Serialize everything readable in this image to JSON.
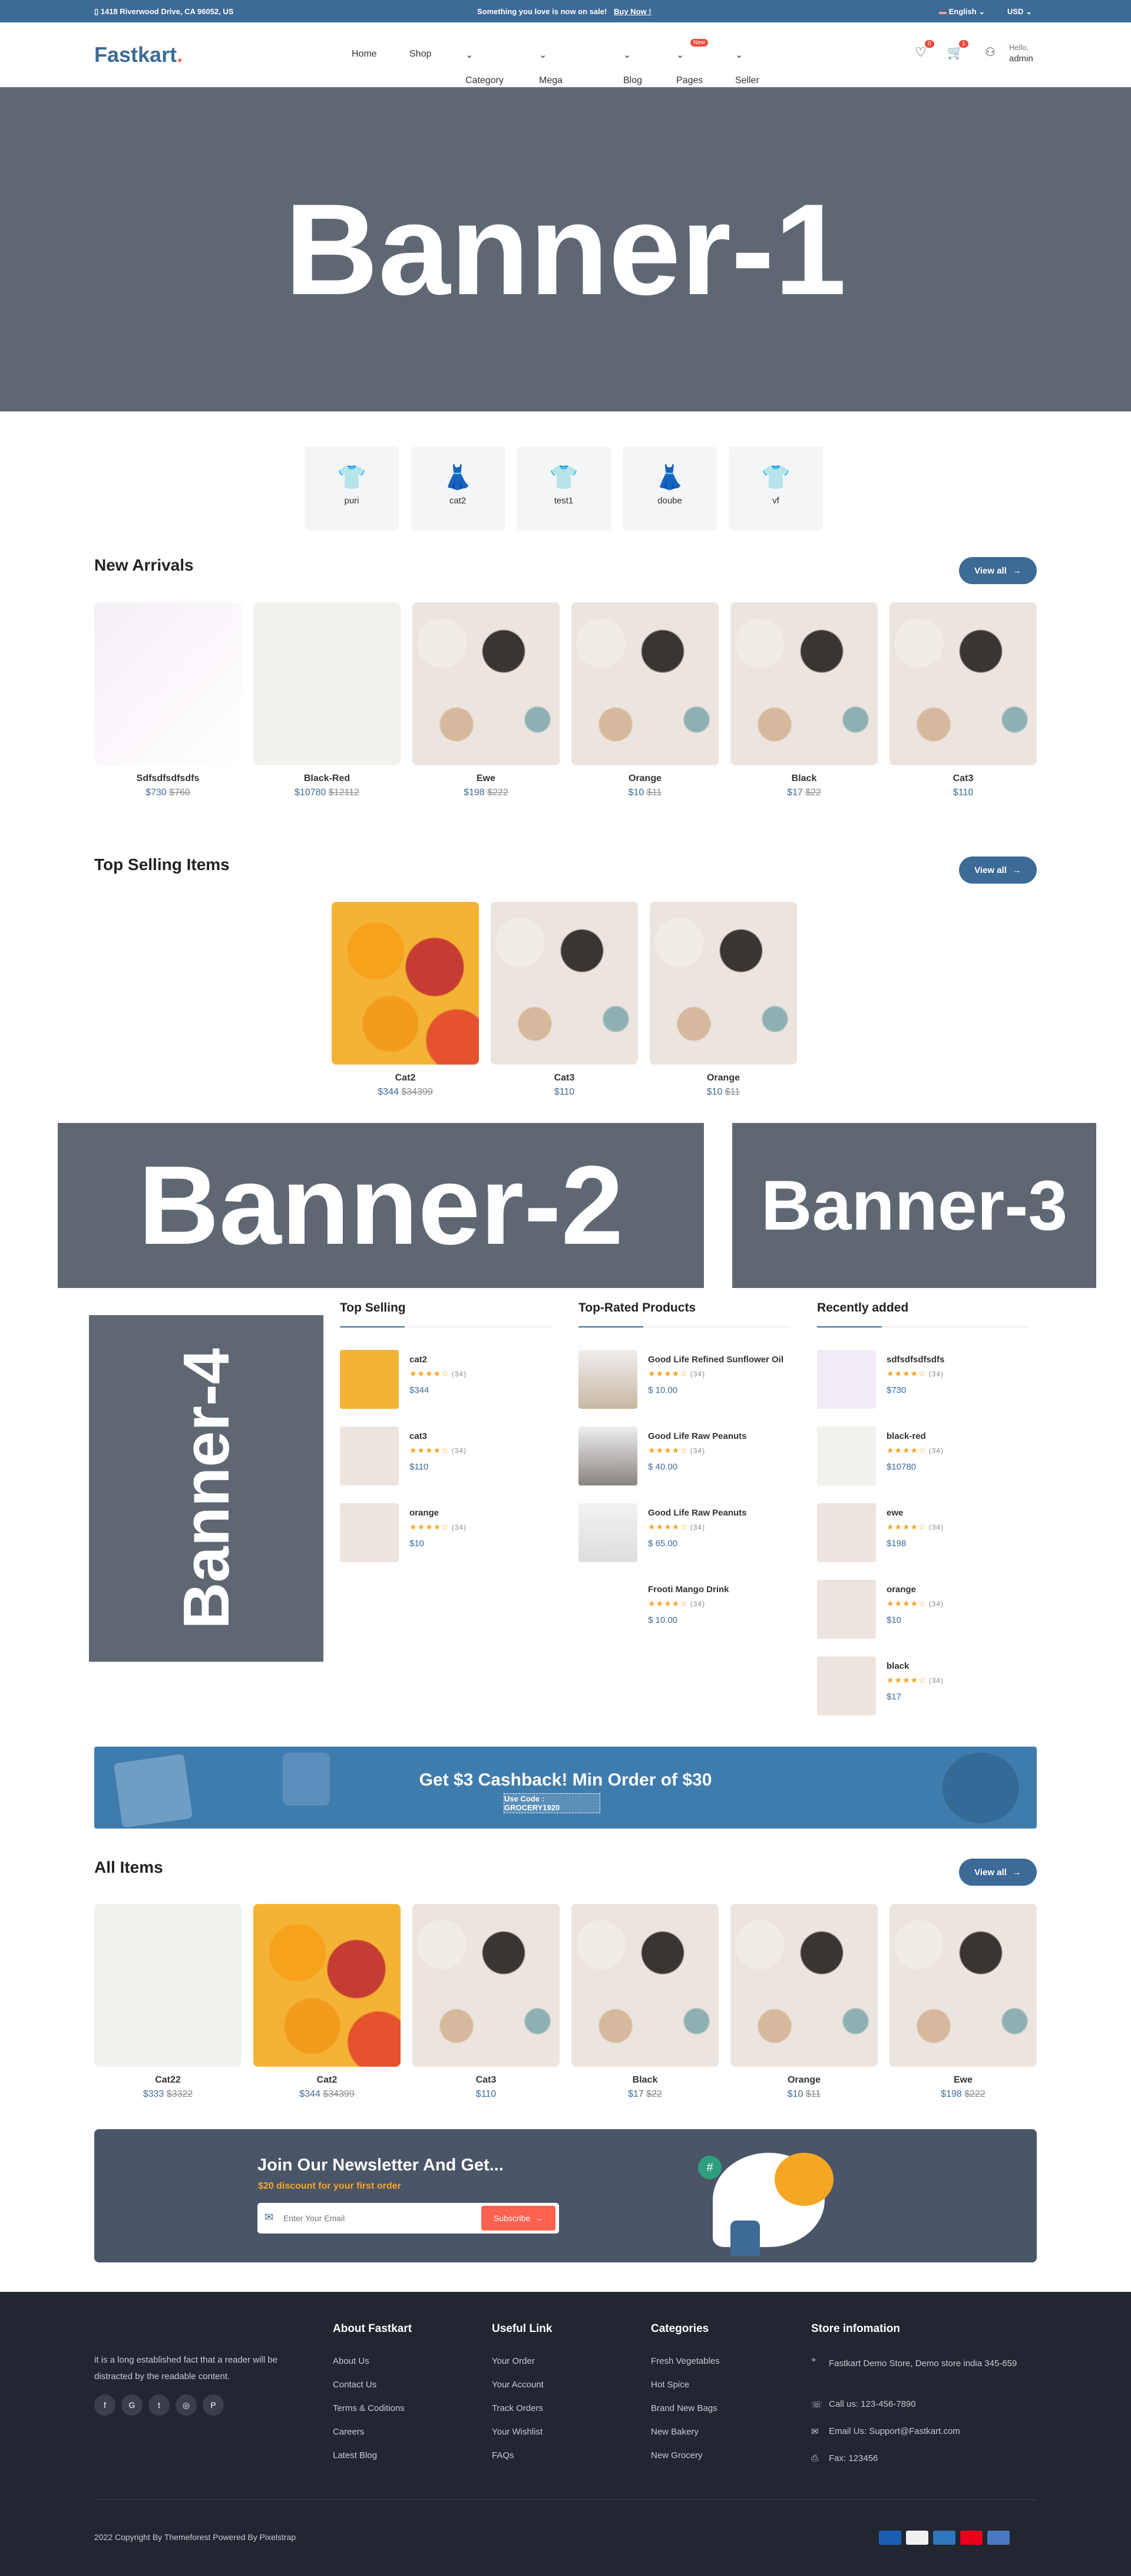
{
  "topbar": {
    "address": "1418 Riverwood Drive, CA 96052, US",
    "promo": "Something you love is now on sale!",
    "promo_link": "Buy Now !",
    "language": "English",
    "currency": "USD"
  },
  "header": {
    "logo": "Fastkart",
    "nav": [
      "Home",
      "Shop",
      "Category",
      "Mega Menu",
      "Blog",
      "Pages",
      "Seller"
    ],
    "new_badge": "New",
    "wishlist_count": "0",
    "cart_count": "1",
    "greeting": "Hello,",
    "user": "admin"
  },
  "banners": {
    "b1": "Banner-1",
    "b2": "Banner-2",
    "b3": "Banner-3",
    "b4": "Banner-4"
  },
  "categories": [
    "puri",
    "cat2",
    "test1",
    "doube",
    "vf"
  ],
  "new_arrivals": {
    "title": "New Arrivals",
    "view_all": "View all",
    "items": [
      {
        "name": "Sdfsdfsdfsdfs",
        "price": "$730",
        "old": "$760",
        "img": "grad"
      },
      {
        "name": "Black-Red",
        "price": "$10780",
        "old": "$12112",
        "img": "leather"
      },
      {
        "name": "Ewe",
        "price": "$198",
        "old": "$222",
        "img": "tea"
      },
      {
        "name": "Orange",
        "price": "$10",
        "old": "$11",
        "img": "tea"
      },
      {
        "name": "Black",
        "price": "$17",
        "old": "$22",
        "img": "tea"
      },
      {
        "name": "Cat3",
        "price": "$110",
        "old": "",
        "img": "tea"
      }
    ]
  },
  "top_selling": {
    "title": "Top Selling Items",
    "view_all": "View all",
    "items": [
      {
        "name": "Cat2",
        "price": "$344",
        "old": "$34399",
        "img": "fruit"
      },
      {
        "name": "Cat3",
        "price": "$110",
        "old": "",
        "img": "tea"
      },
      {
        "name": "Orange",
        "price": "$10",
        "old": "$11",
        "img": "tea"
      }
    ]
  },
  "columns": [
    {
      "title": "Top Selling",
      "items": [
        {
          "name": "cat2",
          "price": "$344",
          "reviews": "(34)",
          "img": "fruit"
        },
        {
          "name": "cat3",
          "price": "$110",
          "reviews": "(34)",
          "img": "tea"
        },
        {
          "name": "orange",
          "price": "$10",
          "reviews": "(34)",
          "img": "tea"
        }
      ]
    },
    {
      "title": "Top-Rated Products",
      "items": [
        {
          "name": "Good Life Refined Sunflower Oil",
          "price": "$ 10.00",
          "reviews": "(34)",
          "img": "person1"
        },
        {
          "name": "Good Life Raw Peanuts",
          "price": "$ 40.00",
          "reviews": "(34)",
          "img": "person2"
        },
        {
          "name": "Good Life Raw Peanuts",
          "price": "$ 65.00",
          "reviews": "(34)",
          "img": "person3"
        },
        {
          "name": "Frooti Mango Drink",
          "price": "$ 10.00",
          "reviews": "(34)",
          "img": "none"
        }
      ]
    },
    {
      "title": "Recently added",
      "items": [
        {
          "name": "sdfsdfsdfsdfs",
          "price": "$730",
          "reviews": "(34)",
          "img": "grad"
        },
        {
          "name": "black-red",
          "price": "$10780",
          "reviews": "(34)",
          "img": "leather"
        },
        {
          "name": "ewe",
          "price": "$198",
          "reviews": "(34)",
          "img": "tea"
        },
        {
          "name": "orange",
          "price": "$10",
          "reviews": "(34)",
          "img": "tea"
        },
        {
          "name": "black",
          "price": "$17",
          "reviews": "(34)",
          "img": "tea"
        }
      ]
    }
  ],
  "rating": 4,
  "cashback": {
    "title": "Get $3 Cashback! Min Order of $30",
    "code": "Use Code : GROCERY1920"
  },
  "all_items": {
    "title": "All Items",
    "view_all": "View all",
    "items": [
      {
        "name": "Cat22",
        "price": "$333",
        "old": "$3322",
        "img": "leather"
      },
      {
        "name": "Cat2",
        "price": "$344",
        "old": "$34399",
        "img": "fruit"
      },
      {
        "name": "Cat3",
        "price": "$110",
        "old": "",
        "img": "tea"
      },
      {
        "name": "Black",
        "price": "$17",
        "old": "$22",
        "img": "tea"
      },
      {
        "name": "Orange",
        "price": "$10",
        "old": "$11",
        "img": "tea"
      },
      {
        "name": "Ewe",
        "price": "$198",
        "old": "$222",
        "img": "tea"
      }
    ]
  },
  "newsletter": {
    "title": "Join Our Newsletter And Get...",
    "subtitle": "$20 discount for your first order",
    "placeholder": "Enter Your Email",
    "button": "Subscribe"
  },
  "footer": {
    "about_text": "it is a long established fact that a reader will be distracted by the readable content.",
    "socials": [
      "f",
      "G",
      "t",
      "◎",
      "P"
    ],
    "about": {
      "title": "About Fastkart",
      "links": [
        "About Us",
        "Contact Us",
        "Terms & Coditions",
        "Careers",
        "Latest Blog"
      ]
    },
    "useful": {
      "title": "Useful Link",
      "links": [
        "Your Order",
        "Your Account",
        "Track Orders",
        "Your Wishlist",
        "FAQs"
      ]
    },
    "categories": {
      "title": "Categories",
      "links": [
        "Fresh Vegetables",
        "Hot Spice",
        "Brand New Bags",
        "New Bakery",
        "New Grocery"
      ]
    },
    "store": {
      "title": "Store infomation",
      "address": "Fastkart Demo Store, Demo store india 345-659",
      "phone": "Call us: 123-456-7890",
      "email": "Email Us: Support@Fastkart.com",
      "fax": "Fax: 123456"
    },
    "copyright": "2022 Copyright By Themeforest Powered By Pixelstrap",
    "payments": [
      "visa",
      "discover",
      "amex",
      "mastercard",
      "card"
    ],
    "payment_colors": [
      "#1a5fb4",
      "#f0f0f0",
      "#2e77bb",
      "#eb001b",
      "#4a78c2"
    ]
  },
  "colors": {
    "primary": "#3d6a96",
    "accent": "#fe6150",
    "banner": "#5f6872",
    "footer": "#222631",
    "star": "#f5a623"
  }
}
